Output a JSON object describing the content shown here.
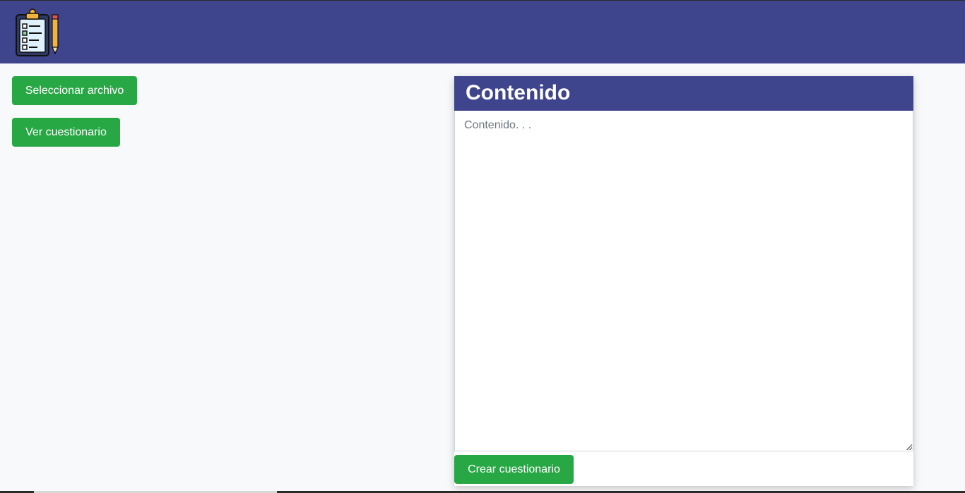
{
  "header": {
    "logo_icon": "clipboard-checklist-pencil-icon",
    "bar_color": "#3f458c"
  },
  "sidebar": {
    "select_file_label": "Seleccionar archivo",
    "view_quiz_label": "Ver cuestionario"
  },
  "panel": {
    "title": "Contenido",
    "content_value": "",
    "content_placeholder": "Contenido. . .",
    "create_label": "Crear cuestionario"
  },
  "colors": {
    "accent": "#3f458c",
    "success": "#28a745",
    "background": "#f8f9fa"
  }
}
